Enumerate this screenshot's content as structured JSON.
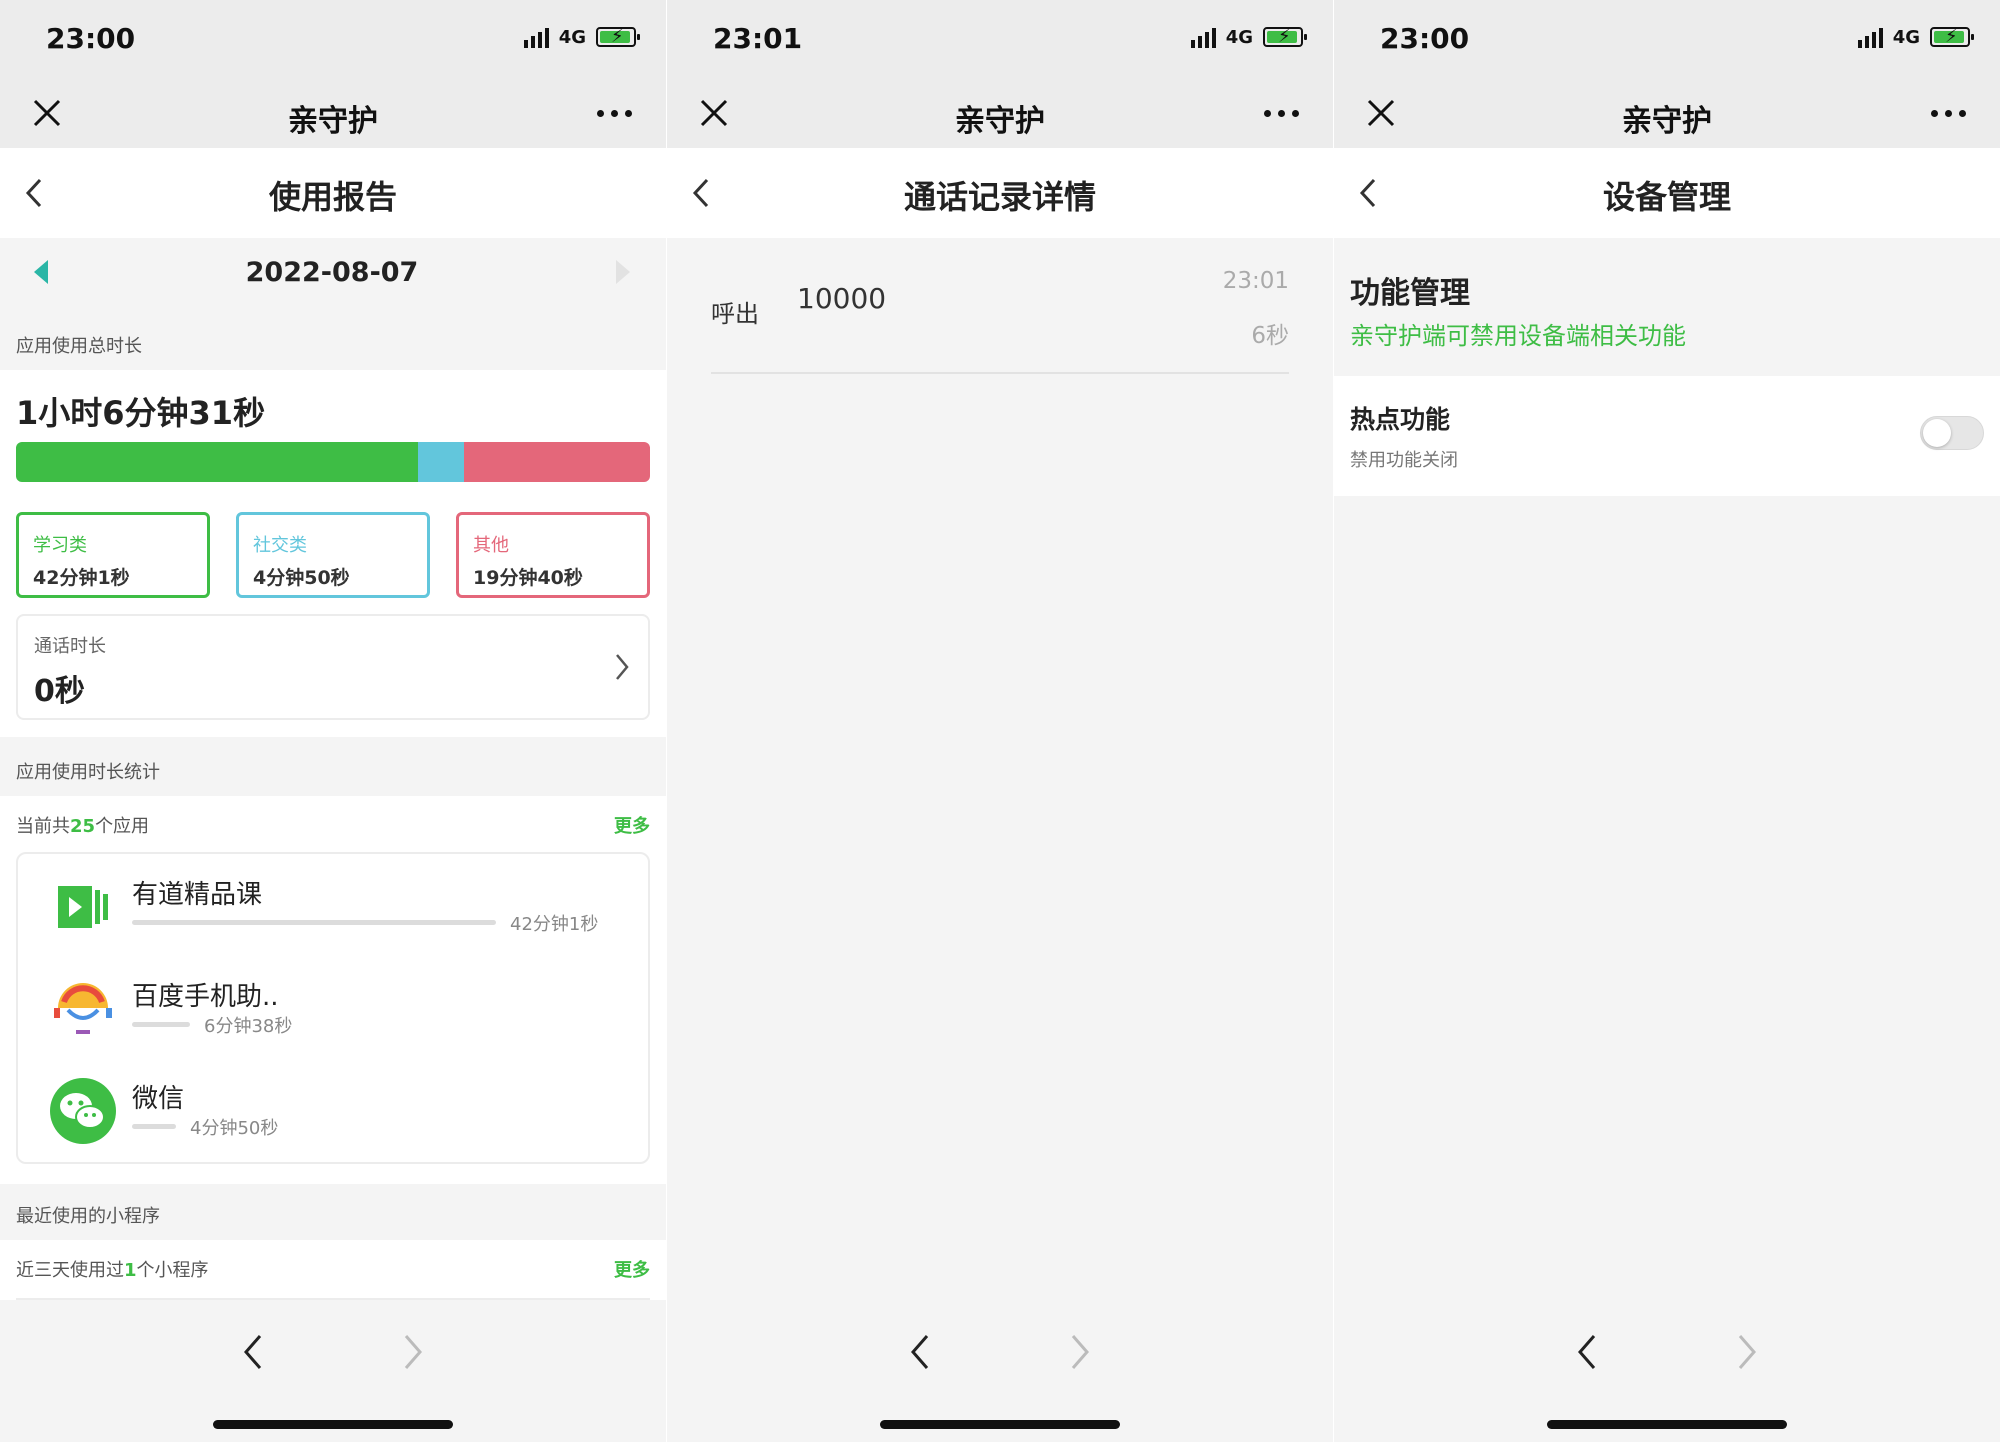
{
  "app_title": "亲守护",
  "screens": [
    {
      "status": {
        "time": "23:00",
        "network": "4G"
      },
      "page_title": "使用报告",
      "date": "2022-08-07",
      "total_label": "应用使用总时长",
      "total_value": "1小时6分钟31秒",
      "usage_fractions": {
        "study": 0.634,
        "social": 0.072,
        "other": 0.294
      },
      "categories": [
        {
          "name": "学习类",
          "value": "42分钟1秒",
          "color": "#3ebd45"
        },
        {
          "name": "社交类",
          "value": "4分钟50秒",
          "color": "#62c6dc"
        },
        {
          "name": "其他",
          "value": "19分钟40秒",
          "color": "#e4677a"
        }
      ],
      "call": {
        "label": "通话时长",
        "value": "0秒"
      },
      "app_stats_label": "应用使用时长统计",
      "app_count": {
        "prefix": "当前共",
        "count": "25",
        "suffix": "个应用"
      },
      "more": "更多",
      "apps": [
        {
          "name": "有道精品课",
          "duration": "42分钟1秒",
          "icon": "youdao-course-icon",
          "fraction": 1.0
        },
        {
          "name": "百度手机助..",
          "duration": "6分钟38秒",
          "icon": "baidu-assistant-icon",
          "fraction": 0.16
        },
        {
          "name": "微信",
          "duration": "4分钟50秒",
          "icon": "wechat-icon",
          "fraction": 0.12
        }
      ],
      "mini_label": "最近使用的小程序",
      "mini_count": {
        "prefix": "近三天使用过",
        "count": "1",
        "suffix": "个小程序"
      }
    },
    {
      "status": {
        "time": "23:01",
        "network": "4G"
      },
      "page_title": "通话记录详情",
      "record": {
        "direction": "呼出",
        "number": "10000",
        "time": "23:01",
        "duration": "6秒"
      }
    },
    {
      "status": {
        "time": "23:00",
        "network": "4G"
      },
      "page_title": "设备管理",
      "function_title": "功能管理",
      "function_subtitle": "亲守护端可禁用设备端相关功能",
      "hotspot": {
        "title": "热点功能",
        "subtitle": "禁用功能关闭",
        "enabled": false
      }
    }
  ],
  "colors": {
    "accent_green": "#3ebd45",
    "social_blue": "#62c6dc",
    "other_red": "#e4677a",
    "date_arrow": "#2ab6a6"
  }
}
